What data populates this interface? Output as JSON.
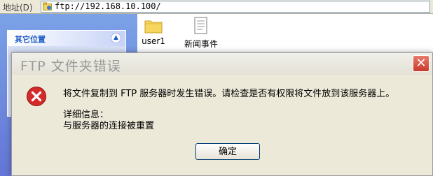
{
  "address_bar": {
    "label": "地址(D)",
    "value": "ftp://192.168.10.100/"
  },
  "sidebar": {
    "panel_title": "其它位置"
  },
  "files": [
    {
      "name": "user1",
      "icon": "folder-icon"
    },
    {
      "name": "新闻事件",
      "icon": "document-icon"
    }
  ],
  "dialog": {
    "title": "FTP 文件夹错误",
    "message": "将文件复制到 FTP 服务器时发生错误。请检查是否有权限将文件放到该服务器上。",
    "detail_label": "详细信息：",
    "detail_text": "与服务器的连接被重置",
    "ok_label": "确定",
    "icon": "error-icon"
  },
  "colors": {
    "sidebar_blue": "#6375d6",
    "dialog_bg": "#ece9d8",
    "error_red": "#d42a2a"
  }
}
